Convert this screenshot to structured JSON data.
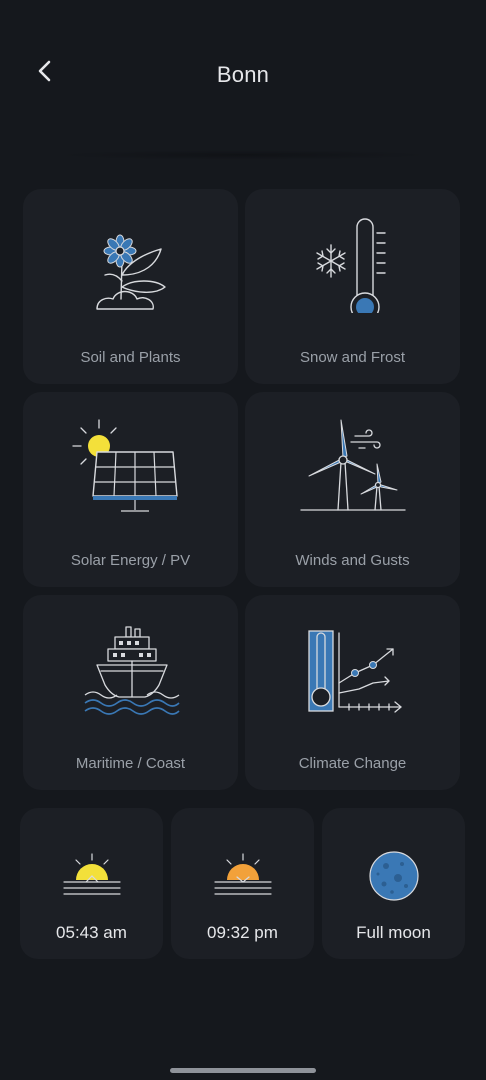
{
  "header": {
    "title": "Bonn",
    "back_icon": "chevron-left-icon"
  },
  "tiles": [
    {
      "label": "Soil and Plants",
      "icon": "plant-flower-icon"
    },
    {
      "label": "Snow and Frost",
      "icon": "snowflake-thermometer-icon"
    },
    {
      "label": "Solar Energy / PV",
      "icon": "solar-panel-icon"
    },
    {
      "label": "Winds and Gusts",
      "icon": "wind-turbine-icon"
    },
    {
      "label": "Maritime / Coast",
      "icon": "ship-icon"
    },
    {
      "label": "Climate Change",
      "icon": "thermometer-chart-icon"
    }
  ],
  "sun_moon": [
    {
      "label": "05:43 am",
      "icon": "sunrise-icon"
    },
    {
      "label": "09:32 pm",
      "icon": "sunset-icon"
    },
    {
      "label": "Full moon",
      "icon": "full-moon-icon"
    }
  ],
  "colors": {
    "background": "#15181d",
    "tile": "#1c1f25",
    "accent_blue": "#3a78b5",
    "sun_yellow": "#f3e03a",
    "sun_orange": "#f2a13a",
    "line": "#d8dade"
  }
}
